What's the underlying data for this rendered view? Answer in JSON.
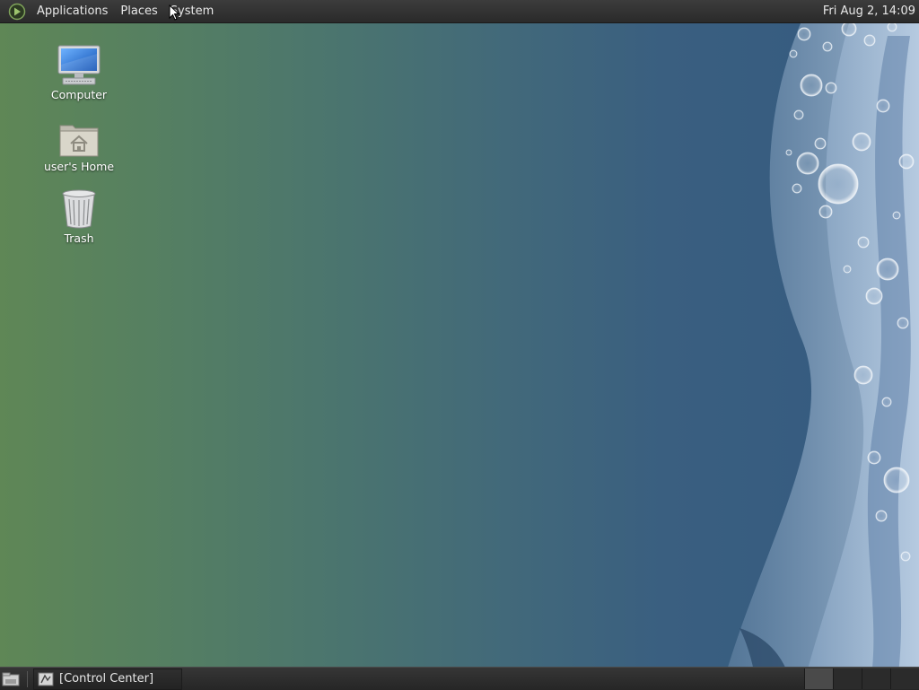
{
  "top_panel": {
    "menus": [
      "Applications",
      "Places",
      "System"
    ],
    "clock": "Fri Aug  2, 14:09",
    "logo_icon": "mate-logo-icon"
  },
  "desktop_icons": [
    {
      "label": "Computer",
      "icon": "computer-icon"
    },
    {
      "label": "user's Home",
      "icon": "home-folder-icon"
    },
    {
      "label": "Trash",
      "icon": "trash-icon"
    }
  ],
  "bottom_panel": {
    "show_desktop_icon": "show-desktop-icon",
    "tasks": [
      {
        "label": "[Control Center]",
        "icon": "control-center-icon"
      }
    ],
    "workspace_count": 4,
    "active_workspace": 1
  },
  "colors": {
    "panel": "#2e2e2e",
    "wallpaper_left": "#5f8756",
    "wallpaper_right": "#345a80"
  }
}
